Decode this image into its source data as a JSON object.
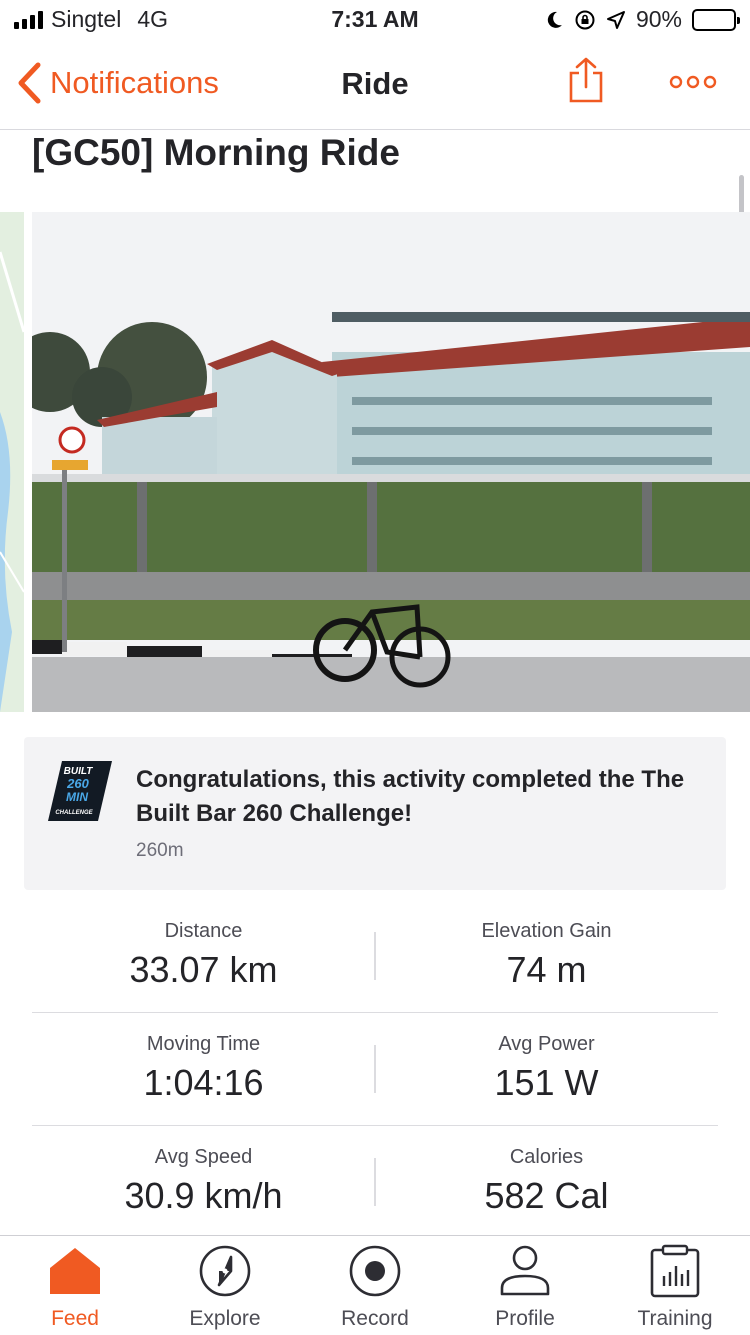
{
  "status_bar": {
    "carrier": "Singtel",
    "network": "4G",
    "time": "7:31 AM",
    "battery": "90%",
    "battery_level": 0.9
  },
  "nav": {
    "back_label": "Notifications",
    "title": "Ride"
  },
  "activity": {
    "title": "[GC50] Morning Ride"
  },
  "challenge": {
    "badge_lines": [
      "BUILT",
      "260",
      "MIN",
      "CHALLENGE"
    ],
    "title": "Congratulations, this activity completed the The Built Bar 260 Challenge!",
    "subtitle": "260m"
  },
  "stats": [
    {
      "left": {
        "label": "Distance",
        "value": "33.07 km"
      },
      "right": {
        "label": "Elevation Gain",
        "value": "74 m"
      }
    },
    {
      "left": {
        "label": "Moving Time",
        "value": "1:04:16"
      },
      "right": {
        "label": "Avg Power",
        "value": "151 W"
      }
    },
    {
      "left": {
        "label": "Avg Speed",
        "value": "30.9 km/h"
      },
      "right": {
        "label": "Calories",
        "value": "582 Cal"
      }
    }
  ],
  "tabs": [
    {
      "label": "Feed",
      "icon": "home-icon",
      "active": true
    },
    {
      "label": "Explore",
      "icon": "compass-icon"
    },
    {
      "label": "Record",
      "icon": "record-icon"
    },
    {
      "label": "Profile",
      "icon": "person-icon"
    },
    {
      "label": "Training",
      "icon": "calendar-chart-icon"
    }
  ],
  "colors": {
    "accent": "#f05a22",
    "text": "#242428",
    "muted": "#6d6d78",
    "card_bg": "#f3f3f5"
  }
}
